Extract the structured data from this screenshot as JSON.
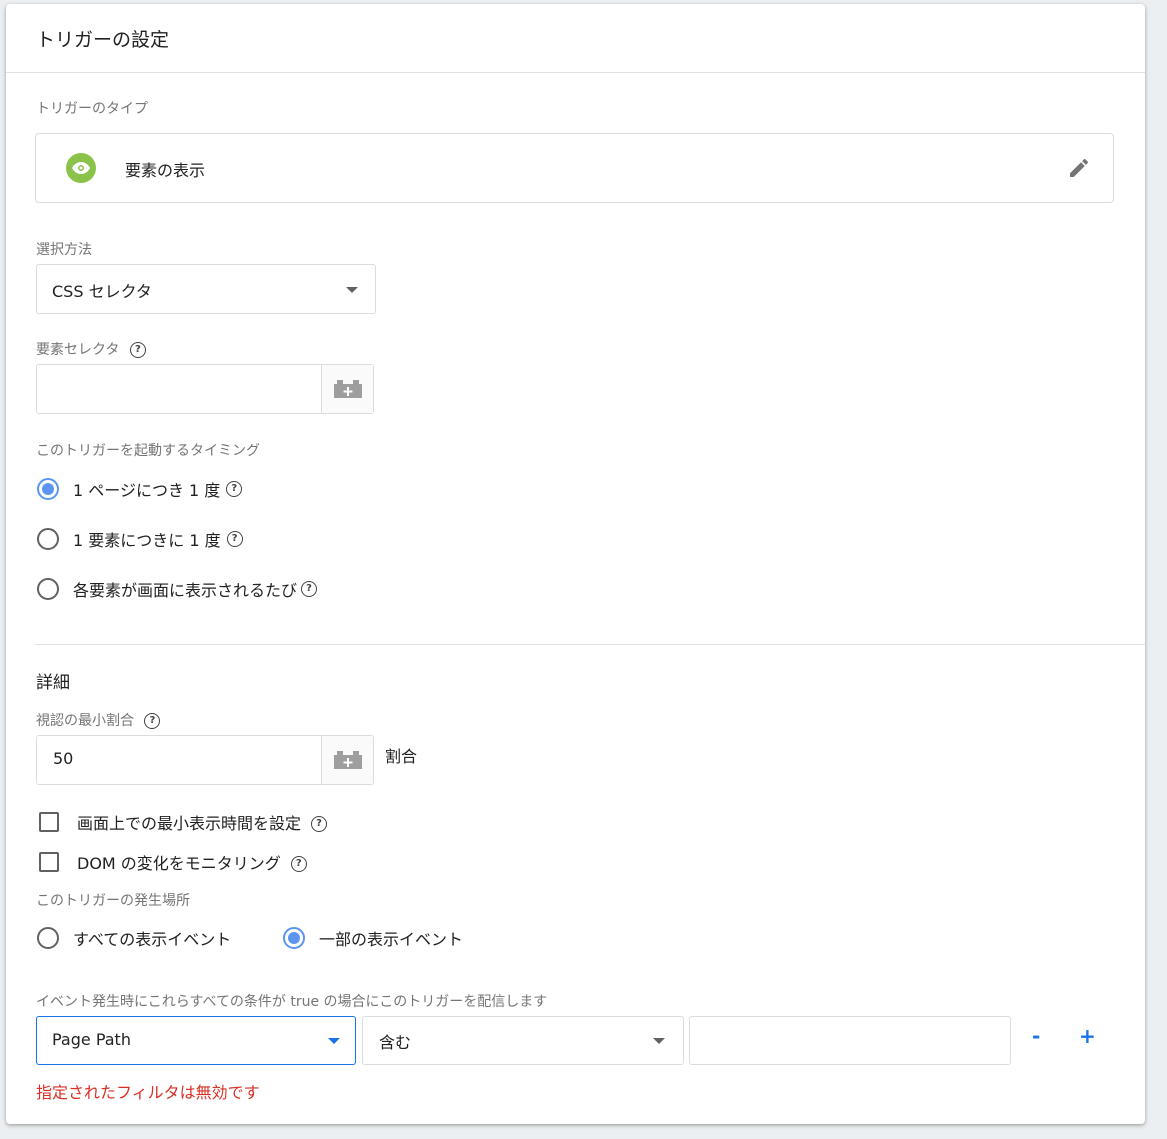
{
  "title": "トリガーの設定",
  "trigger_type": {
    "label": "トリガーのタイプ",
    "value": "要素の表示",
    "icon": "eye-icon",
    "edit_icon": "pencil-icon",
    "accent": "#8bc34a"
  },
  "selection_method": {
    "label": "選択方法",
    "value": "CSS セレクタ"
  },
  "element_selector": {
    "label": "要素セレクタ",
    "value": ""
  },
  "timing": {
    "label": "このトリガーを起動するタイミング",
    "options": [
      {
        "label": "1 ページにつき 1 度",
        "selected": true
      },
      {
        "label": "1 要素につきに 1 度",
        "selected": false
      },
      {
        "label": "各要素が画面に表示されるたび",
        "selected": false
      }
    ]
  },
  "details": {
    "heading": "詳細",
    "min_visible_label": "視認の最小割合",
    "min_visible_value": "50",
    "min_visible_unit": "割合",
    "checkboxes": [
      {
        "label": "画面上での最小表示時間を設定",
        "checked": false
      },
      {
        "label": "DOM の変化をモニタリング",
        "checked": false
      }
    ]
  },
  "fire_on": {
    "label": "このトリガーの発生場所",
    "options": [
      {
        "label": "すべての表示イベント",
        "selected": false
      },
      {
        "label": "一部の表示イベント",
        "selected": true
      }
    ]
  },
  "condition": {
    "label": "イベント発生時にこれらすべての条件が true の場合にこのトリガーを配信します",
    "variable": "Page Path",
    "operator": "含む",
    "value": "",
    "remove_label": "-",
    "add_label": "+",
    "error": "指定されたフィルタは無効です"
  },
  "colors": {
    "radio_selected": "#5b95f0",
    "focus_border": "#1a73e8",
    "error": "#d93025"
  }
}
